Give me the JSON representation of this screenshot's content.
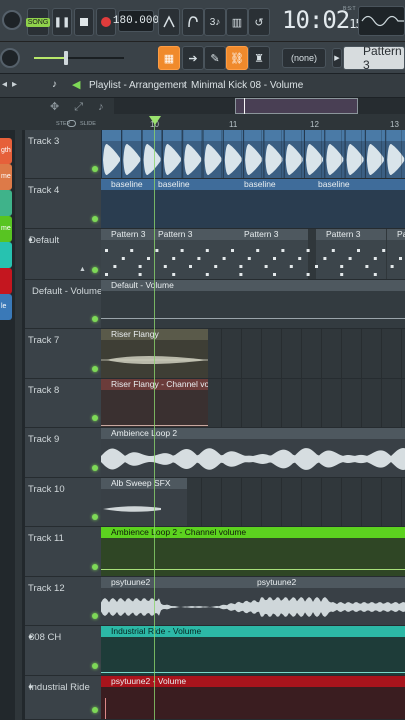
{
  "toolbar": {
    "song_label": "SONG",
    "tempo": "180.000",
    "time_main": "10:02",
    "time_sub": "15",
    "time_unit": "B:S:T",
    "snap_none": "(none)",
    "pattern": "Pattern 3"
  },
  "breadcrumb": {
    "view": "Playlist - Arrangement",
    "sep": "›",
    "clip": "Minimal Kick 08 - Volume"
  },
  "ruler": {
    "step_label": "STEP",
    "slide_label": "SLIDE",
    "bars": [
      "10",
      "11",
      "12",
      "13"
    ]
  },
  "sidebar_tabs": [
    "gth",
    "me",
    "",
    "me",
    "",
    "",
    "le"
  ],
  "tracks": [
    {
      "name": "Track 3"
    },
    {
      "name": "Track 4"
    },
    {
      "name": "Default"
    },
    {
      "name": "Default - Volume"
    },
    {
      "name": "Track 7"
    },
    {
      "name": "Track 8"
    },
    {
      "name": "Track 9"
    },
    {
      "name": "Track 10"
    },
    {
      "name": "Track 11"
    },
    {
      "name": "Track 12"
    },
    {
      "name": "808 CH"
    },
    {
      "name": "Industrial Ride"
    }
  ],
  "clips": {
    "t4": [
      "baseline",
      "baseline",
      "baseline",
      "baseline"
    ],
    "default": [
      "Pattern 3",
      "Pattern 3",
      "Pattern 3",
      "Pattern 3",
      "Pattern 3"
    ],
    "defvol": "Default - Volume",
    "t7": "Riser Flangy",
    "t8": "Riser Flangy - Channel volume",
    "t9": "Ambience Loop 2",
    "t10": "Alb Sweep SFX",
    "t11": "Ambience Loop 2 - Channel volume",
    "t12": [
      "psytuune2",
      "psytuune2"
    ],
    "ch808": "Industrial Ride - Volume",
    "ride": "psytuune2 - Volume"
  },
  "colors": {
    "audio_blue": "#3f6c9a",
    "pattern_gray": "#4e585f",
    "green_auto": "#5cd21f",
    "teal_auto": "#2cb8a6",
    "red_auto": "#a8141c",
    "salmon_auto": "#6b3c3a",
    "riser": "#5a5a4a",
    "accent": "#f08a2c"
  }
}
